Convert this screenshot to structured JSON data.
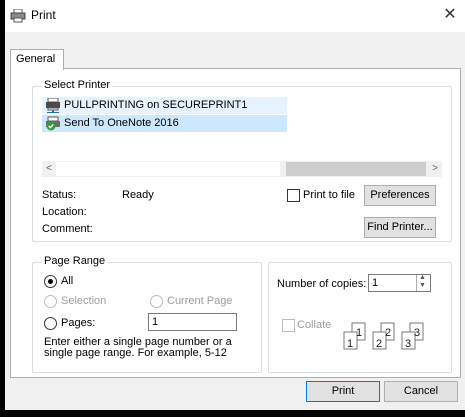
{
  "window": {
    "title": "Print",
    "close_glyph": "✕"
  },
  "tabs": [
    {
      "label": "General",
      "selected": true
    }
  ],
  "select_printer": {
    "label": "Select Printer",
    "printers": [
      {
        "name": "PULLPRINTING on SECUREPRINT1",
        "icon": "network-printer-icon",
        "state": "hover"
      },
      {
        "name": "Send To OneNote 2016",
        "icon": "default-printer-icon",
        "state": "selected"
      }
    ]
  },
  "status": {
    "status_label": "Status:",
    "status_value": "Ready",
    "location_label": "Location:",
    "location_value": "",
    "comment_label": "Comment:",
    "comment_value": ""
  },
  "print_to_file": {
    "label": "Print to file",
    "checked": false
  },
  "buttons": {
    "preferences": "Preferences",
    "find_printer": "Find Printer...",
    "print": "Print",
    "cancel": "Cancel"
  },
  "page_range": {
    "label": "Page Range",
    "all": "All",
    "selection": "Selection",
    "current_page": "Current Page",
    "pages": "Pages:",
    "pages_value": "1",
    "help": "Enter either a single page number or a single page range.  For example, 5-12",
    "selected": "All"
  },
  "copies": {
    "label": "Number of copies:",
    "value": "1",
    "collate_label": "Collate",
    "collate_checked": false,
    "collate_pages": [
      "1",
      "1",
      "2",
      "2",
      "3",
      "3"
    ]
  },
  "colors": {
    "selection": "#cce8ff",
    "hover": "#e5f3ff",
    "client_bg": "#f0f0f0"
  }
}
